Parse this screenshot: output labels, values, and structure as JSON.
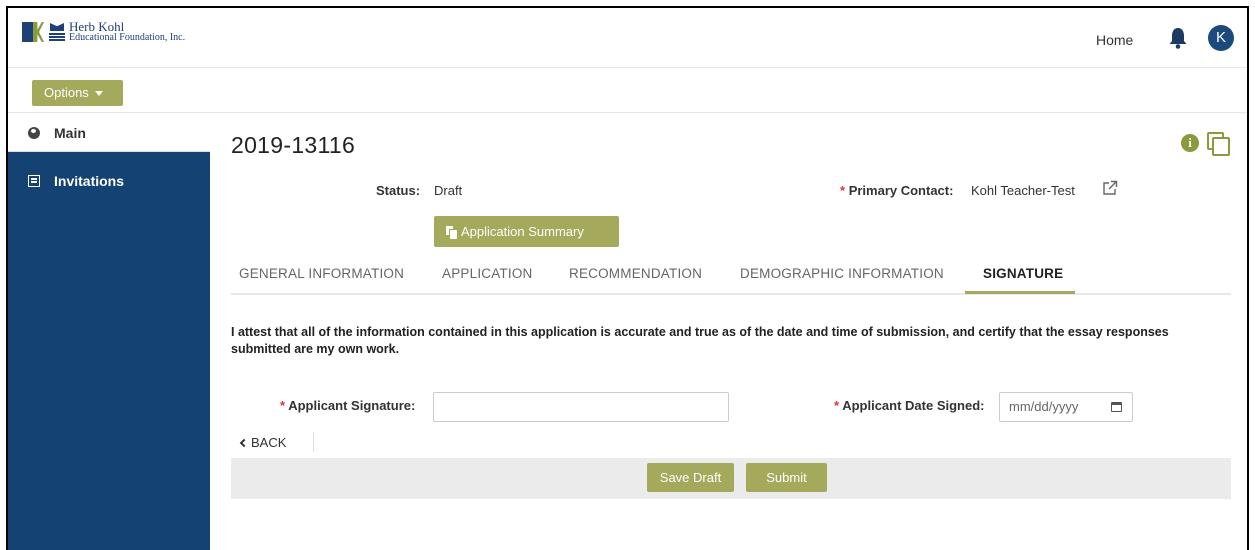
{
  "header": {
    "logo_line1": "Herb Kohl",
    "logo_line2": "Educational Foundation, Inc.",
    "logo_mark_text": "HK",
    "home_label": "Home",
    "avatar_initial": "K"
  },
  "toolbar": {
    "options_label": "Options"
  },
  "sidebar": {
    "items": [
      {
        "label": "Main",
        "icon": "globe-icon"
      },
      {
        "label": "Invitations",
        "icon": "list-icon"
      }
    ]
  },
  "record": {
    "title": "2019-13116",
    "status_label": "Status:",
    "status_value": "Draft",
    "primary_contact_label": "Primary Contact:",
    "primary_contact_value": "Kohl Teacher-Test",
    "summary_button": "Application Summary"
  },
  "tabs": [
    {
      "label": "GENERAL INFORMATION"
    },
    {
      "label": "APPLICATION"
    },
    {
      "label": "RECOMMENDATION"
    },
    {
      "label": "DEMOGRAPHIC INFORMATION"
    },
    {
      "label": "SIGNATURE",
      "active": true
    }
  ],
  "form": {
    "attestation": "I attest that all of the information contained in this application is accurate and true as of the date and time of submission, and certify that the essay responses submitted are my own work.",
    "signature_label": "Applicant Signature:",
    "signature_value": "",
    "date_label": "Applicant Date Signed:",
    "date_placeholder": "mm/dd/yyyy",
    "required_marker": "*"
  },
  "nav": {
    "back_label": "BACK"
  },
  "actions": {
    "save_label": "Save Draft",
    "submit_label": "Submit"
  },
  "colors": {
    "accent": "#a5a95b",
    "sidebar": "#134273",
    "required": "#d9383a"
  }
}
